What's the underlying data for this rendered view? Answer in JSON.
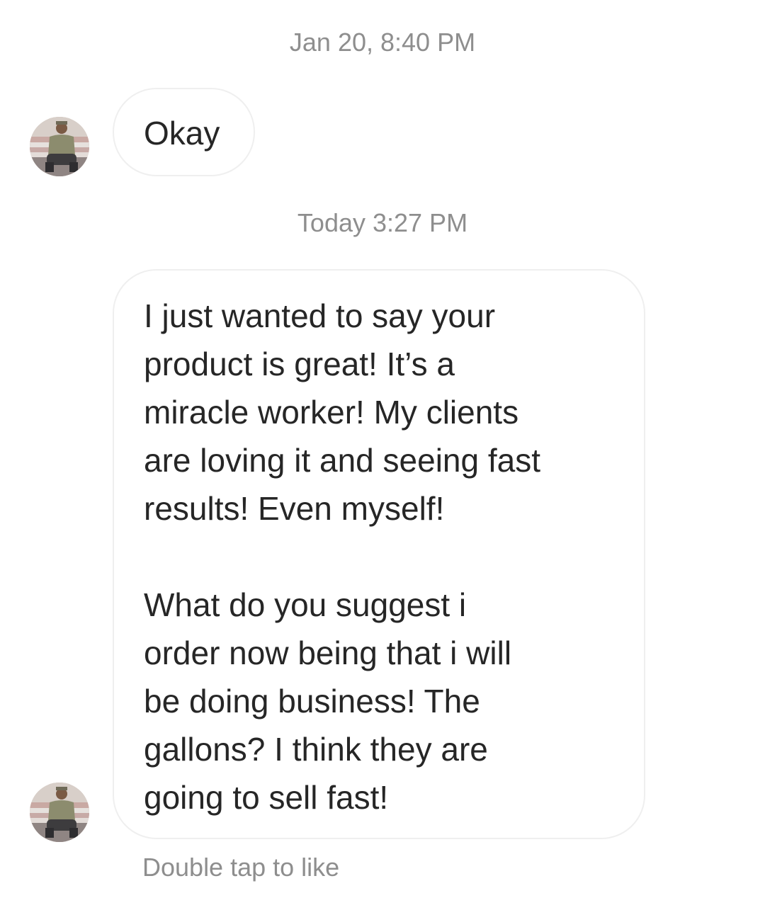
{
  "conversation": {
    "timestamps": [
      "Jan 20, 8:40 PM",
      "Today 3:27 PM"
    ],
    "messages": [
      {
        "sender": "other",
        "text": "Okay"
      },
      {
        "sender": "other",
        "text": "I just wanted to say your\nproduct is great! It’s a\nmiracle worker! My clients\nare loving it and seeing fast\nresults! Even myself!\n\nWhat do you suggest i\norder now being that i will\nbe doing business! The\ngallons? I think they are\ngoing to sell fast!"
      }
    ],
    "double_tap_hint": "Double tap to like"
  },
  "colors": {
    "text": "#262626",
    "muted": "#8e8e8e",
    "bubble_border": "#efefef",
    "background": "#ffffff"
  },
  "icons": {
    "avatar": "profile-photo-avatar"
  }
}
